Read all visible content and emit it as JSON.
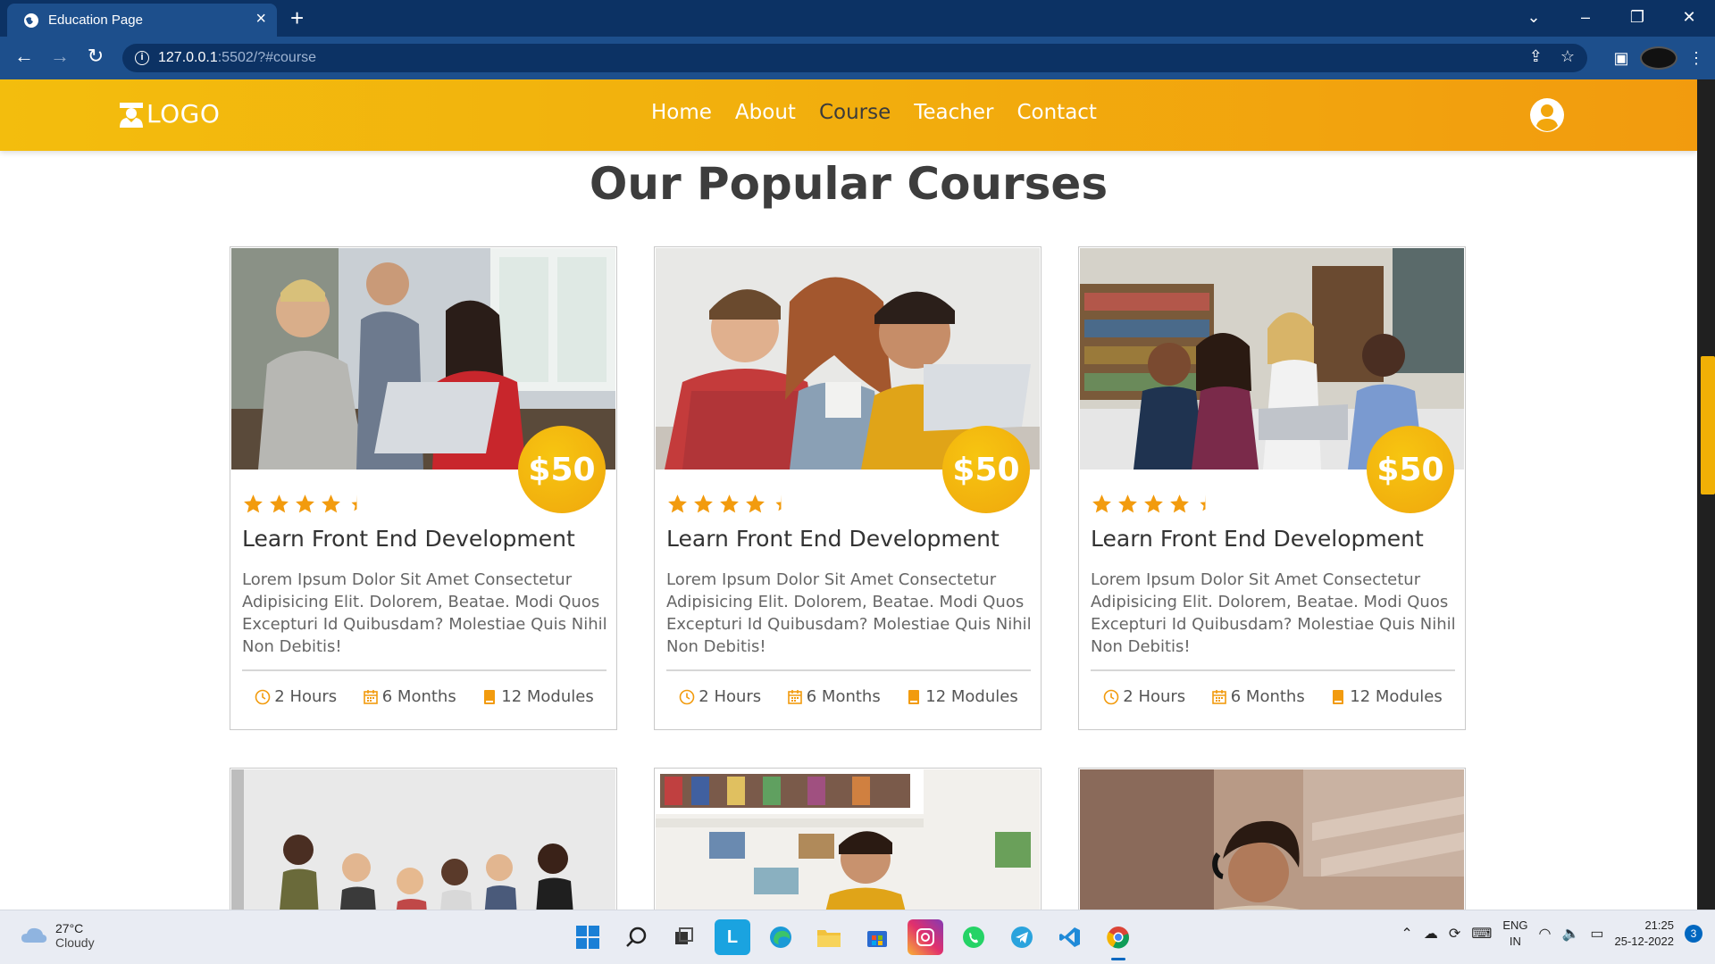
{
  "browser": {
    "tab_title": "Education Page",
    "url_host": "127.0.0.1",
    "url_rest": ":5502/?#course"
  },
  "site": {
    "logo_text": "LOGO",
    "nav": [
      "Home",
      "About",
      "Course",
      "Teacher",
      "Contact"
    ],
    "active_nav": "Course",
    "section_title": "Our Popular Courses"
  },
  "courses": [
    {
      "price": "$50",
      "rating": 4.5,
      "title": "Learn Front End Development",
      "description": "Lorem Ipsum Dolor Sit Amet Consectetur Adipisicing Elit. Dolorem, Beatae. Modi Quos Excepturi Id Quibusdam? Molestiae Quis Nihil Non Debitis!",
      "hours": "2 Hours",
      "months": "6 Months",
      "modules": "12 Modules"
    },
    {
      "price": "$50",
      "rating": 4.5,
      "title": "Learn Front End Development",
      "description": "Lorem Ipsum Dolor Sit Amet Consectetur Adipisicing Elit. Dolorem, Beatae. Modi Quos Excepturi Id Quibusdam? Molestiae Quis Nihil Non Debitis!",
      "hours": "2 Hours",
      "months": "6 Months",
      "modules": "12 Modules"
    },
    {
      "price": "$50",
      "rating": 4.5,
      "title": "Learn Front End Development",
      "description": "Lorem Ipsum Dolor Sit Amet Consectetur Adipisicing Elit. Dolorem, Beatae. Modi Quos Excepturi Id Quibusdam? Molestiae Quis Nihil Non Debitis!",
      "hours": "2 Hours",
      "months": "6 Months",
      "modules": "12 Modules"
    }
  ],
  "taskbar": {
    "temperature": "27°C",
    "weather": "Cloudy",
    "lang_top": "ENG",
    "lang_bottom": "IN",
    "time": "21:25",
    "date": "25-12-2022",
    "notifications": "3"
  },
  "colors": {
    "accent": "#f2ae0d",
    "browser_dark": "#0c3264",
    "browser_mid": "#1d4f8c"
  }
}
